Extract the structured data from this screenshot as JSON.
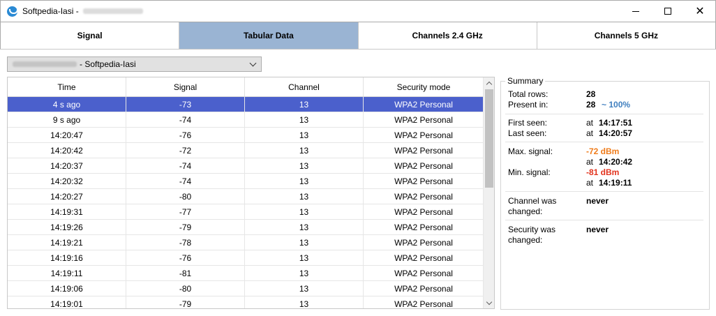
{
  "window": {
    "title": "Softpedia-Iasi -",
    "close_glyph": "✕"
  },
  "tabs": [
    {
      "label": "Signal",
      "active": false
    },
    {
      "label": "Tabular Data",
      "active": true
    },
    {
      "label": "Channels 2.4 GHz",
      "active": false
    },
    {
      "label": "Channels 5 GHz",
      "active": false
    }
  ],
  "network_select": {
    "value": "- Softpedia-Iasi"
  },
  "table": {
    "columns": [
      "Time",
      "Signal",
      "Channel",
      "Security mode"
    ],
    "rows": [
      [
        "4 s ago",
        "-73",
        "13",
        "WPA2 Personal"
      ],
      [
        "9 s ago",
        "-74",
        "13",
        "WPA2 Personal"
      ],
      [
        "14:20:47",
        "-76",
        "13",
        "WPA2 Personal"
      ],
      [
        "14:20:42",
        "-72",
        "13",
        "WPA2 Personal"
      ],
      [
        "14:20:37",
        "-74",
        "13",
        "WPA2 Personal"
      ],
      [
        "14:20:32",
        "-74",
        "13",
        "WPA2 Personal"
      ],
      [
        "14:20:27",
        "-80",
        "13",
        "WPA2 Personal"
      ],
      [
        "14:19:31",
        "-77",
        "13",
        "WPA2 Personal"
      ],
      [
        "14:19:26",
        "-79",
        "13",
        "WPA2 Personal"
      ],
      [
        "14:19:21",
        "-78",
        "13",
        "WPA2 Personal"
      ],
      [
        "14:19:16",
        "-76",
        "13",
        "WPA2 Personal"
      ],
      [
        "14:19:11",
        "-81",
        "13",
        "WPA2 Personal"
      ],
      [
        "14:19:06",
        "-80",
        "13",
        "WPA2 Personal"
      ],
      [
        "14:19:01",
        "-79",
        "13",
        "WPA2 Personal"
      ]
    ],
    "selected_row": 0
  },
  "summary": {
    "legend": "Summary",
    "total_rows_label": "Total rows:",
    "total_rows_value": "28",
    "present_in_label": "Present in:",
    "present_in_value": "28",
    "present_in_pct": "~ 100%",
    "first_seen_label": "First seen:",
    "first_seen_value": "14:17:51",
    "last_seen_label": "Last seen:",
    "last_seen_value": "14:20:57",
    "at_label": "at",
    "max_signal_label": "Max. signal:",
    "max_signal_value": "-72 dBm",
    "max_signal_at": "14:20:42",
    "min_signal_label": "Min. signal:",
    "min_signal_value": "-81 dBm",
    "min_signal_at": "14:19:11",
    "channel_changed_label_1": "Channel was",
    "channel_changed_label_2": "changed:",
    "channel_changed_value": "never",
    "security_changed_label_1": "Security was",
    "security_changed_label_2": "changed:",
    "security_changed_value": "never"
  },
  "colors": {
    "tab_active": "#9ab4d3",
    "row_selected": "#4b60cc",
    "max_signal": "#ef7c1b",
    "min_signal": "#e2331d",
    "percent": "#3f7fbf"
  },
  "icons": {
    "app": "wifi-analyzer-icon",
    "minimize": "minimize-icon",
    "maximize": "maximize-icon",
    "close": "close-icon",
    "dropdown": "chevron-down-icon",
    "scroll_up": "scroll-up-arrow-icon",
    "scroll_down": "scroll-down-arrow-icon"
  }
}
